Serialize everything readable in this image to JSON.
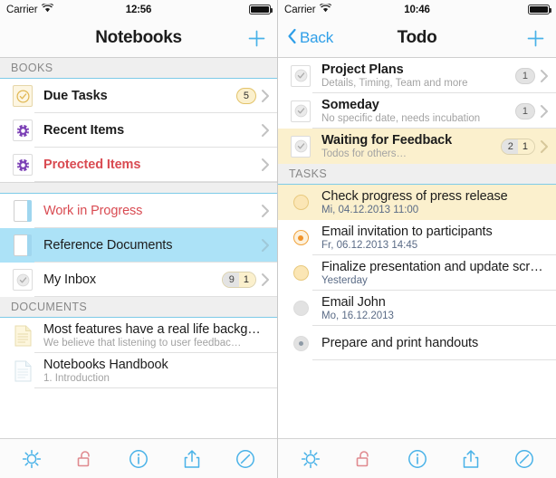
{
  "left": {
    "status": {
      "carrier": "Carrier",
      "wifi_icon": "wifi-icon",
      "time": "12:56",
      "battery_icon": "battery-icon"
    },
    "nav": {
      "title": "Notebooks",
      "add_label": "+",
      "add_icon": "plus-icon"
    },
    "sections": [
      {
        "header": "BOOKS",
        "rows": [
          {
            "icon": "check-circle-icon",
            "title": "Due Tasks",
            "badge": "5",
            "badge_style": "gold",
            "chevron": "chevron-right-icon"
          },
          {
            "icon": "gear-circle-icon",
            "title": "Recent Items",
            "chevron": "chevron-right-icon"
          },
          {
            "icon": "gear-circle-icon",
            "title": "Protected Items",
            "chevron": "chevron-right-icon"
          }
        ]
      },
      {
        "header": "",
        "rows": [
          {
            "icon": "notebook-icon",
            "title": "Work in Progress",
            "chevron": "chevron-right-icon"
          },
          {
            "icon": "notebook-icon",
            "title": "Reference Documents",
            "chevron": "chevron-right-icon"
          },
          {
            "icon": "check-circle-grey-icon",
            "title": "My Inbox",
            "badge_a": "9",
            "badge_b": "1",
            "chevron": "chevron-right-icon"
          }
        ]
      },
      {
        "header": "DOCUMENTS",
        "rows": [
          {
            "icon": "document-yellow-icon",
            "title": "Most features have a real life backg…",
            "sub": "We believe that listening to user feedbac…"
          },
          {
            "icon": "document-blue-icon",
            "title": "Notebooks Handbook",
            "sub": "1. Introduction"
          }
        ]
      }
    ],
    "toolbar": [
      {
        "name": "settings-gear-icon",
        "label": "Settings"
      },
      {
        "name": "unlock-icon",
        "label": "Unlock"
      },
      {
        "name": "info-icon",
        "label": "Info"
      },
      {
        "name": "share-icon",
        "label": "Share"
      },
      {
        "name": "compose-icon",
        "label": "Compose"
      }
    ]
  },
  "right": {
    "status": {
      "carrier": "Carrier",
      "wifi_icon": "wifi-icon",
      "time": "10:46",
      "battery_icon": "battery-icon"
    },
    "nav": {
      "back_label": "Back",
      "back_icon": "chevron-left-icon",
      "title": "Todo",
      "add_label": "+",
      "add_icon": "plus-icon"
    },
    "books": [
      {
        "icon": "check-square-grey-icon",
        "title": "Project Plans",
        "sub": "Details, Timing, Team and more",
        "badge": "1",
        "badge_style": "grey",
        "chevron": "chevron-right-icon"
      },
      {
        "icon": "check-square-grey-icon",
        "title": "Someday",
        "sub": "No specific date, needs incubation",
        "badge": "1",
        "badge_style": "grey",
        "chevron": "chevron-right-icon"
      },
      {
        "icon": "check-square-grey-icon",
        "title": "Waiting for Feedback",
        "sub": "Todos for others…",
        "badge_a": "2",
        "badge_b": "1",
        "chevron": "chevron-right-icon",
        "highlight": true
      }
    ],
    "tasks_header": "TASKS",
    "tasks": [
      {
        "icon": "task-circle-open-gold-icon",
        "title": "Check progress of press release",
        "date": "Mi, 04.12.2013 11:00",
        "highlight": true
      },
      {
        "icon": "task-circle-orange-dot-icon",
        "title": "Email invitation to participants",
        "date": "Fr, 06.12.2013 14:45"
      },
      {
        "icon": "task-circle-open-gold-icon",
        "title": "Finalize presentation and update scr…",
        "date": "Yesterday"
      },
      {
        "icon": "task-circle-grey-icon",
        "title": "Email John",
        "date": "Mo, 16.12.2013"
      },
      {
        "icon": "task-circle-grey-dot-icon",
        "title": "Prepare and print handouts",
        "date": ""
      }
    ],
    "toolbar": [
      {
        "name": "settings-gear-icon",
        "label": "Settings"
      },
      {
        "name": "unlock-icon",
        "label": "Unlock"
      },
      {
        "name": "info-icon",
        "label": "Info"
      },
      {
        "name": "share-icon",
        "label": "Share"
      },
      {
        "name": "compose-icon",
        "label": "Compose"
      }
    ]
  },
  "colors": {
    "accent_blue": "#49b2e8",
    "section_border": "#7ecbe8",
    "selected_row": "#ace2f7",
    "highlight_row": "#fbf0cd",
    "red_text": "#d94b52",
    "gold": "#e3c36a",
    "orange": "#f0932b",
    "purple": "#7b3fb5"
  }
}
